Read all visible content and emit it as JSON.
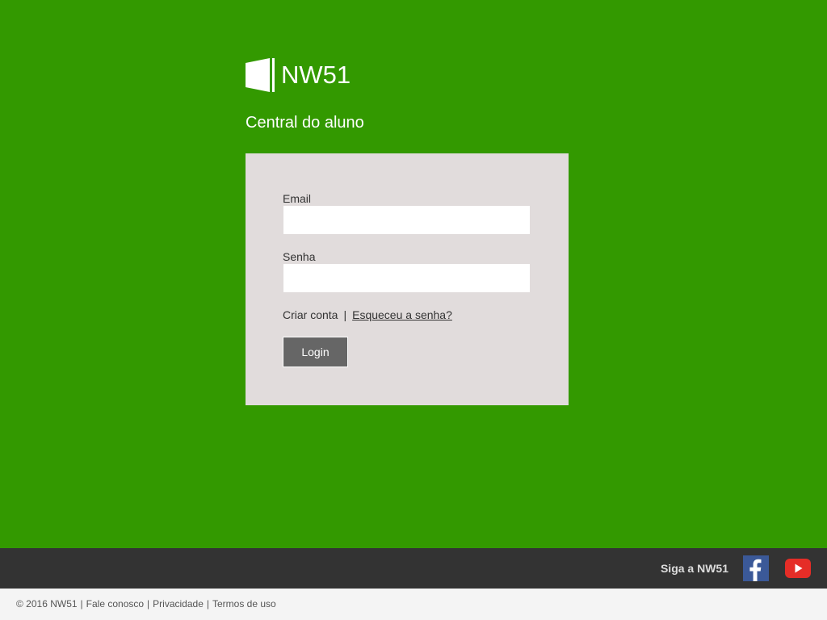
{
  "brand": {
    "name": "NW51",
    "subtitle": "Central do aluno",
    "logo_icon": "windows-logo-icon"
  },
  "colors": {
    "background": "#339900",
    "card": "#e1dcdc",
    "button": "#666666",
    "social_bar": "#333333",
    "footer": "#f4f4f4",
    "facebook": "#3b5998",
    "youtube": "#e52d27"
  },
  "login_form": {
    "email_label": "Email",
    "email_value": "",
    "email_placeholder": "",
    "password_label": "Senha",
    "password_value": "",
    "password_placeholder": "",
    "create_account": "Criar conta",
    "separator": "|",
    "forgot_password": "Esqueceu a senha?",
    "login_button": "Login"
  },
  "social": {
    "follow_text": "Siga a NW51",
    "icons": [
      "facebook-icon",
      "youtube-icon"
    ]
  },
  "footer": {
    "copyright": "© 2016 NW51",
    "separator": "|",
    "contact": "Fale conosco",
    "privacy": "Privacidade",
    "terms": "Termos de uso"
  }
}
